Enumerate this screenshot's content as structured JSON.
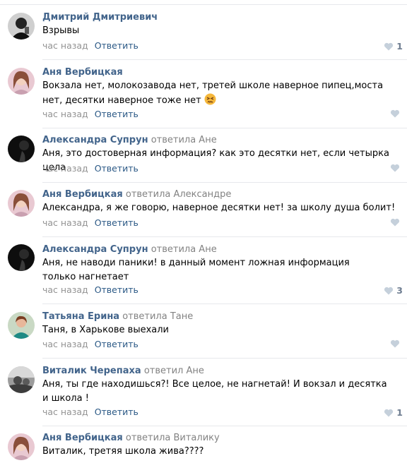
{
  "colors": {
    "author": "#42648b",
    "link": "#2a5885",
    "meta": "#939393",
    "like": "#c5d0db",
    "separator": "#e7e8ec"
  },
  "comments": [
    {
      "author": "Дмитрий Дмитриевич",
      "reply_to": "",
      "text": "Взрывы",
      "time": "час назад",
      "reply_label": "Ответить",
      "likes": "1"
    },
    {
      "author": "Аня Вербицкая",
      "reply_to": "",
      "text": "Вокзала нет, молокозавода нет, третей школе наверное пипец,моста нет, десятки наверное тоже нет",
      "emoji": "confounded-face-icon",
      "time": "час назад",
      "reply_label": "Ответить",
      "likes": ""
    },
    {
      "author": "Александра Супрун",
      "reply_to": "ответила Ане",
      "text": "Аня, это достоверная информация? как это десятки нет, если четырка цела",
      "time": "час назад",
      "reply_label": "Ответить",
      "likes": ""
    },
    {
      "author": "Аня Вербицкая",
      "reply_to": "ответила Александре",
      "text": "Александра, я же говорю, наверное десятки нет! за школу душа болит!",
      "time": "час назад",
      "reply_label": "Ответить",
      "likes": ""
    },
    {
      "author": "Александра Супрун",
      "reply_to": "ответила Ане",
      "text": "Аня, не наводи паники! в данный момент ложная информация только нагнетает",
      "time": "час назад",
      "reply_label": "Ответить",
      "likes": "3"
    },
    {
      "author": "Татьяна Ерина",
      "reply_to": "ответила Тане",
      "text": "Таня, в Харькове выехали",
      "time": "час назад",
      "reply_label": "Ответить",
      "likes": ""
    },
    {
      "author": "Виталик Черепаха",
      "reply_to": "ответил Ане",
      "text": "Аня, ты где находишься?! Все целое, не нагнетай! И вокзал и десятка и школа !",
      "time": "час назад",
      "reply_label": "Ответить",
      "likes": "1"
    },
    {
      "author": "Аня Вербицкая",
      "reply_to": "ответила Виталику",
      "text": "Виталик, третяя школа жива????",
      "time": "",
      "reply_label": "",
      "likes": ""
    }
  ]
}
